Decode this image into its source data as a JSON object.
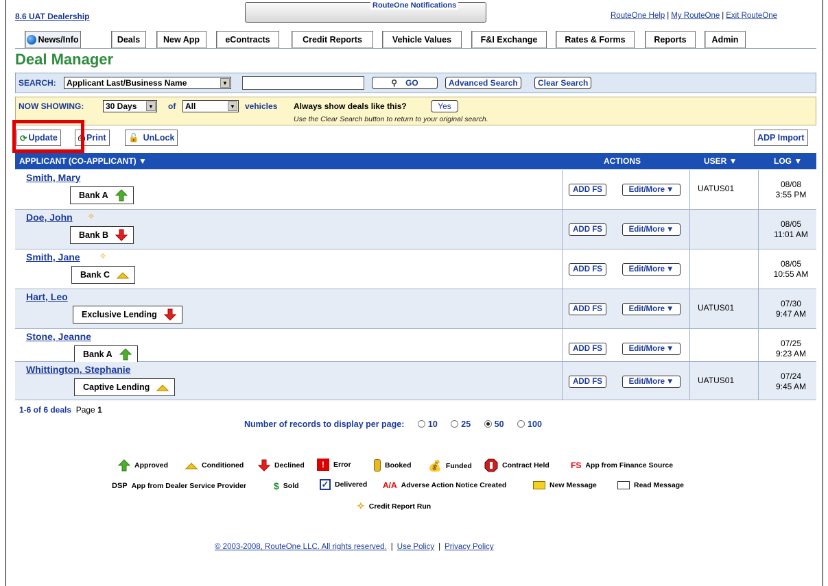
{
  "header": {
    "dealership": "8.6 UAT Dealership",
    "notifications_label": "RouteOne Notifications",
    "links": [
      "RouteOne Help",
      "My RouteOne",
      "Exit RouteOne"
    ]
  },
  "tabs": [
    "News/Info",
    "Deals",
    "New App",
    "eContracts",
    "Credit Reports",
    "Vehicle Values",
    "F&I Exchange",
    "Rates & Forms",
    "Reports",
    "Admin"
  ],
  "page_title": "Deal Manager",
  "search": {
    "label": "SEARCH:",
    "field_selected": "Applicant Last/Business Name",
    "value": "",
    "go": "GO",
    "advanced": "Advanced Search",
    "clear": "Clear Search"
  },
  "now_showing": {
    "label": "NOW SHOWING:",
    "days": "30 Days",
    "of": "of",
    "vehicles_filter": "All",
    "vehicles": "vehicles",
    "always_show": "Always show deals like this?",
    "yes": "Yes",
    "hint": "Use the Clear Search button to return to your original search."
  },
  "toolbar": {
    "update": "Update",
    "print": "Print",
    "unlock": "UnLock",
    "adp_import": "ADP Import"
  },
  "table": {
    "headers": {
      "applicant": "APPLICANT (CO-APPLICANT)",
      "actions": "ACTIONS",
      "user": "USER",
      "log": "LOG"
    },
    "add_fs": "ADD FS",
    "edit_more": "Edit/More",
    "rows": [
      {
        "name": "Smith, Mary",
        "lender": "Bank A",
        "status": "approved",
        "credit": false,
        "user": "UATUS01",
        "date": "08/08",
        "time": "3:55 PM"
      },
      {
        "name": "Doe, John",
        "lender": "Bank B",
        "status": "declined",
        "credit": true,
        "user": "",
        "date": "08/05",
        "time": "11:01 AM"
      },
      {
        "name": "Smith, Jane",
        "lender": "Bank C",
        "status": "conditioned",
        "credit": true,
        "user": "",
        "date": "08/05",
        "time": "10:55 AM"
      },
      {
        "name": "Hart, Leo",
        "lender": "Exclusive Lending",
        "status": "declined",
        "credit": false,
        "user": "UATUS01",
        "date": "07/30",
        "time": "9:47 AM"
      },
      {
        "name": "Stone, Jeanne",
        "lender": "Bank A",
        "status": "approved",
        "credit": false,
        "user": "",
        "date": "07/25",
        "time": "9:23 AM"
      },
      {
        "name": "Whittington, Stephanie",
        "lender": "Captive Lending",
        "status": "conditioned",
        "credit": false,
        "user": "UATUS01",
        "date": "07/24",
        "time": "9:45 AM"
      }
    ]
  },
  "footer": {
    "count": "1-6 of 6 deals",
    "page_label": "Page",
    "page": "1",
    "records_label": "Number of records to display per page:",
    "records_options": [
      "10",
      "25",
      "50",
      "100"
    ],
    "records_selected": "50"
  },
  "legend": {
    "approved": "Approved",
    "conditioned": "Conditioned",
    "declined": "Declined",
    "error": "Error",
    "booked": "Booked",
    "funded": "Funded",
    "contract_held": "Contract Held",
    "fs_code": "FS",
    "fs": "App from Finance Source",
    "dsp_code": "DSP",
    "dsp": "App from Dealer Service Provider",
    "sold": "Sold",
    "delivered": "Delivered",
    "aa_code": "A/A",
    "adverse": "Adverse Action Notice Created",
    "new_message": "New Message",
    "read_message": "Read Message",
    "credit_report": "Credit Report Run"
  },
  "copyright": {
    "text": "© 2003-2008, RouteOne LLC. All rights reserved.",
    "use_policy": "Use Policy",
    "privacy_policy": "Privacy Policy"
  },
  "colors": {
    "brand_blue": "#1a3a9a",
    "header_blue": "#1b4fb3",
    "title_green": "#2e8b3e",
    "highlight_red": "#e00000"
  }
}
